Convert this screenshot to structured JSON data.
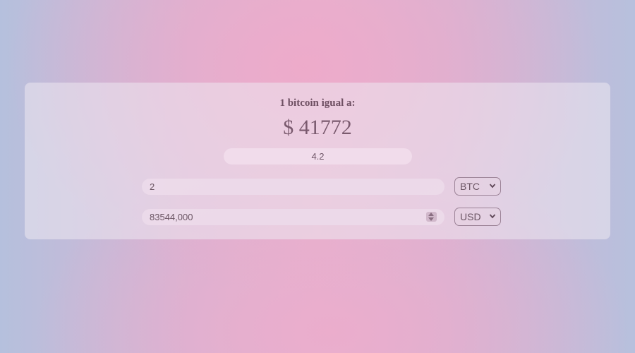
{
  "converter": {
    "title": "1 bitcoin igual a:",
    "price": "$ 41772",
    "ratio": "4.2",
    "amount_value": "2",
    "result_value": "83544,000",
    "from_currency": "BTC",
    "to_currency": "USD"
  },
  "icons": {
    "select_arrow": "chevron-down-icon",
    "number_spinner": "spinner-icon"
  },
  "colors": {
    "text": "#6e4f62",
    "card": "#e6e2ea",
    "background_pink": "#eeaacb",
    "background_blue": "#b5c0dd"
  }
}
